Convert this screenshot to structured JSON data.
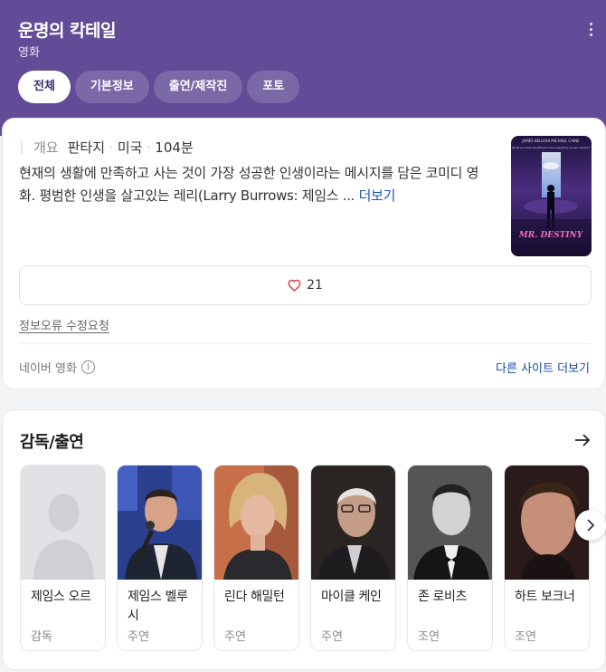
{
  "header": {
    "title": "운명의 칵테일",
    "subtitle": "영화",
    "tabs": [
      {
        "label": "전체",
        "active": true
      },
      {
        "label": "기본정보",
        "active": false
      },
      {
        "label": "출연/제작진",
        "active": false
      },
      {
        "label": "포토",
        "active": false
      }
    ],
    "colors": {
      "background": "#624c97",
      "active_tab_text": "#3f2e73"
    }
  },
  "overview": {
    "label": "개요",
    "genre": "판타지",
    "country": "미국",
    "runtime": "104분",
    "separator": "·",
    "description": "현재의 생활에 만족하고 사는 것이 가장 성공한 인생이라는 메시지를 담은 코미디 영화. 평범한 인생을 살고있는 레리(Larry Burrows: 제임스 ...",
    "more_label": "더보기",
    "poster": {
      "top_credits": "JAMES BELUSHI    MICHAEL CAINE",
      "tagline": "Would you trade everything to have everything you ever wanted?",
      "title": "MR. DESTINY"
    },
    "likes": "21",
    "report_label": "정보오류 수정요청",
    "source_label": "네이버 영화",
    "info_icon": "i",
    "other_sites_label": "다른 사이트 더보기"
  },
  "cast": {
    "title": "감독/출연",
    "people": [
      {
        "name": "제임스 오르",
        "role": "감독"
      },
      {
        "name": "제임스 벨루시",
        "role": "주연"
      },
      {
        "name": "린다 해밀턴",
        "role": "주연"
      },
      {
        "name": "마이클 케인",
        "role": "주연"
      },
      {
        "name": "존 로비츠",
        "role": "조연"
      },
      {
        "name": "하트 보크너",
        "role": "조연"
      }
    ]
  },
  "icons": {
    "kebab": "more-vertical-icon",
    "heart": "heart-icon",
    "info": "info-icon",
    "arrow": "arrow-right-icon",
    "next": "chevron-right-icon"
  },
  "colors": {
    "link": "#1a55c4",
    "heart": "#e0323c"
  }
}
